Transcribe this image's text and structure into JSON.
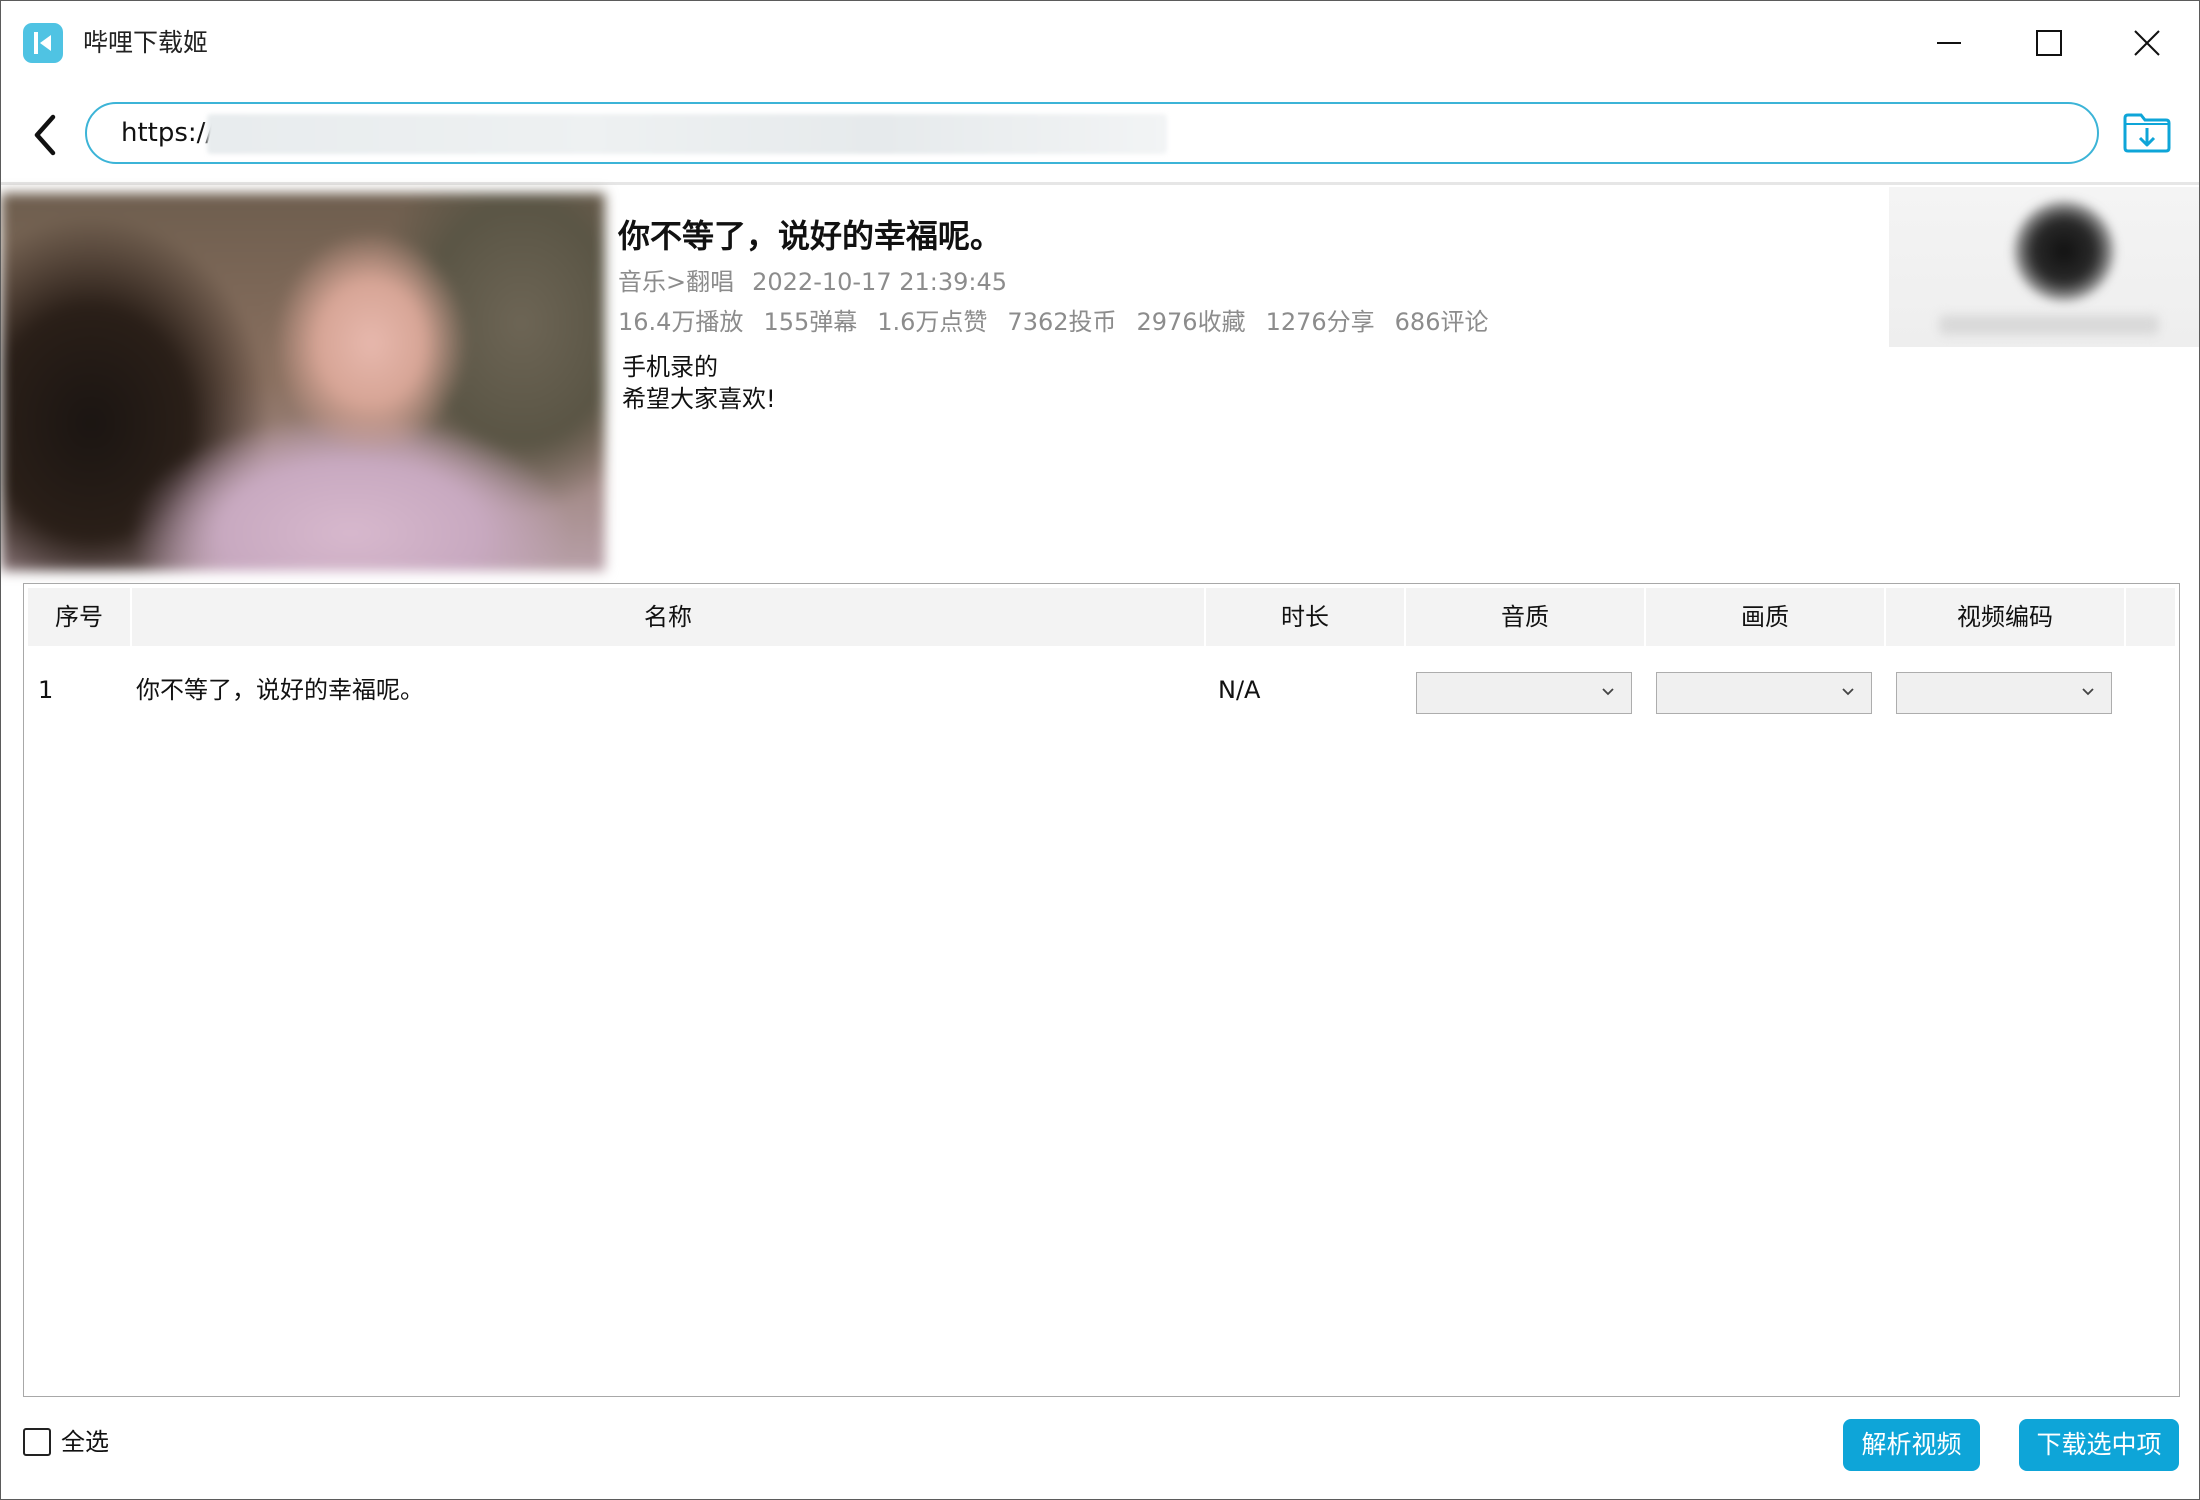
{
  "window": {
    "title": "哔哩下载姬",
    "accent_color": "#0ea5d8",
    "icons": [
      "app-logo-icon",
      "minimize-icon",
      "maximize-icon",
      "close-icon"
    ]
  },
  "url_bar": {
    "value": "https://",
    "back_icon": "chevron-left-icon",
    "download_icon": "download-folder-icon"
  },
  "video": {
    "title": "你不等了，说好的幸福呢。",
    "category": "音乐>翻唱",
    "publish_time": "2022-10-17 21:39:45",
    "stats": {
      "plays": "16.4万播放",
      "danmaku": "155弹幕",
      "likes": "1.6万点赞",
      "coins": "7362投币",
      "favorites": "2976收藏",
      "shares": "1276分享",
      "comments": "686评论"
    },
    "description": "手机录的\n希望大家喜欢!"
  },
  "table": {
    "columns": {
      "index": "序号",
      "name": "名称",
      "duration": "时长",
      "audio_quality": "音质",
      "video_quality": "画质",
      "video_codec": "视频编码"
    },
    "rows": [
      {
        "index": "1",
        "name": "你不等了，说好的幸福呢。",
        "duration": "N/A",
        "audio_quality": "",
        "video_quality": "",
        "video_codec": ""
      }
    ]
  },
  "footer": {
    "select_all_label": "全选",
    "select_all_checked": false,
    "parse_button": "解析视频",
    "download_button": "下载选中项"
  }
}
